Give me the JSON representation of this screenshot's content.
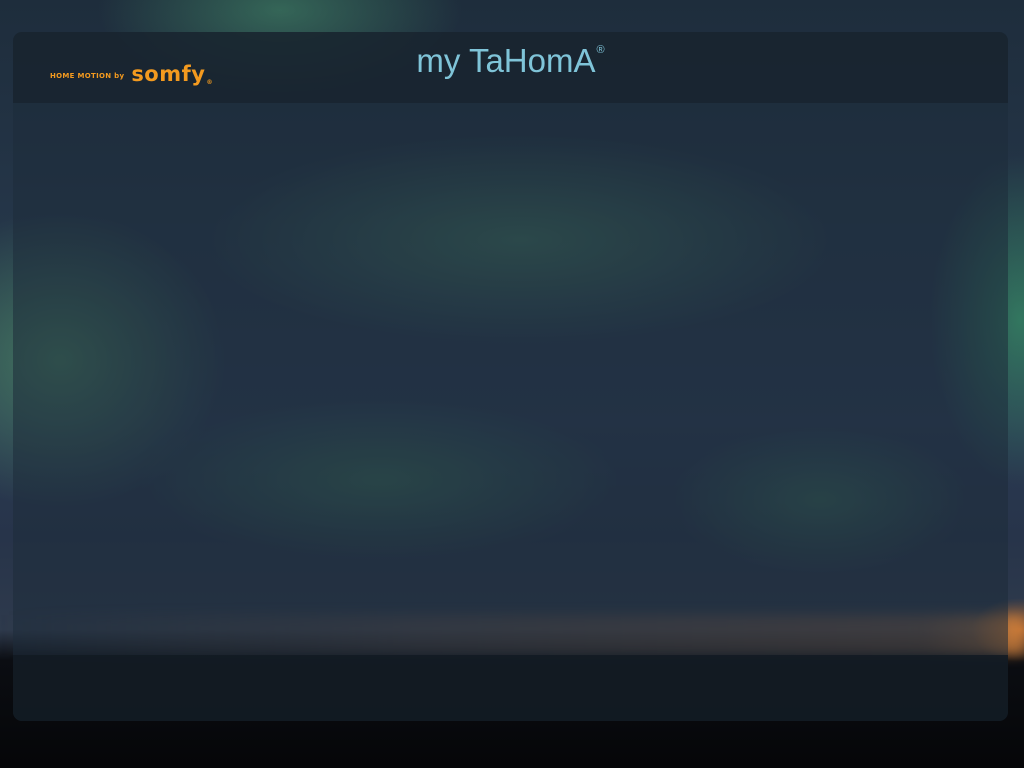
{
  "header": {
    "brand_tagline": "HOME MOTION by",
    "brand_name": "somfy",
    "brand_mark": "®",
    "app_title": "my TaHomA",
    "app_title_mark": "®"
  },
  "colors": {
    "brand_orange": "#f39a1f",
    "title_blue": "#7fc4d8",
    "header_bar": "#18222c",
    "footer_bar": "#121a22"
  },
  "background": {
    "description_icon": "aurora-background-image"
  }
}
